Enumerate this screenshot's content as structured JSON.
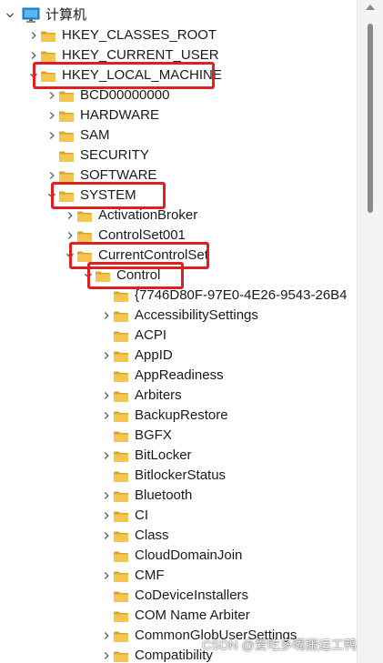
{
  "tree": {
    "root_label": "计算机",
    "items": [
      {
        "label": "HKEY_CLASSES_ROOT",
        "level": 1,
        "expander": "collapsed"
      },
      {
        "label": "HKEY_CURRENT_USER",
        "level": 1,
        "expander": "collapsed"
      },
      {
        "label": "HKEY_LOCAL_MACHINE",
        "level": 1,
        "expander": "expanded"
      },
      {
        "label": "BCD00000000",
        "level": 2,
        "expander": "collapsed"
      },
      {
        "label": "HARDWARE",
        "level": 2,
        "expander": "collapsed"
      },
      {
        "label": "SAM",
        "level": 2,
        "expander": "collapsed"
      },
      {
        "label": "SECURITY",
        "level": 2,
        "expander": "none"
      },
      {
        "label": "SOFTWARE",
        "level": 2,
        "expander": "collapsed"
      },
      {
        "label": "SYSTEM",
        "level": 2,
        "expander": "expanded"
      },
      {
        "label": "ActivationBroker",
        "level": 3,
        "expander": "collapsed"
      },
      {
        "label": "ControlSet001",
        "level": 3,
        "expander": "collapsed"
      },
      {
        "label": "CurrentControlSet",
        "level": 3,
        "expander": "expanded"
      },
      {
        "label": "Control",
        "level": 4,
        "expander": "expanded"
      },
      {
        "label": "{7746D80F-97E0-4E26-9543-26B4",
        "level": 5,
        "expander": "none"
      },
      {
        "label": "AccessibilitySettings",
        "level": 5,
        "expander": "collapsed"
      },
      {
        "label": "ACPI",
        "level": 5,
        "expander": "none"
      },
      {
        "label": "AppID",
        "level": 5,
        "expander": "collapsed"
      },
      {
        "label": "AppReadiness",
        "level": 5,
        "expander": "none"
      },
      {
        "label": "Arbiters",
        "level": 5,
        "expander": "collapsed"
      },
      {
        "label": "BackupRestore",
        "level": 5,
        "expander": "collapsed"
      },
      {
        "label": "BGFX",
        "level": 5,
        "expander": "none"
      },
      {
        "label": "BitLocker",
        "level": 5,
        "expander": "collapsed"
      },
      {
        "label": "BitlockerStatus",
        "level": 5,
        "expander": "none"
      },
      {
        "label": "Bluetooth",
        "level": 5,
        "expander": "collapsed"
      },
      {
        "label": "CI",
        "level": 5,
        "expander": "collapsed"
      },
      {
        "label": "Class",
        "level": 5,
        "expander": "collapsed"
      },
      {
        "label": "CloudDomainJoin",
        "level": 5,
        "expander": "none"
      },
      {
        "label": "CMF",
        "level": 5,
        "expander": "collapsed"
      },
      {
        "label": "CoDeviceInstallers",
        "level": 5,
        "expander": "none"
      },
      {
        "label": "COM Name Arbiter",
        "level": 5,
        "expander": "none"
      },
      {
        "label": "CommonGlobUserSettings",
        "level": 5,
        "expander": "collapsed"
      },
      {
        "label": "Compatibility",
        "level": 5,
        "expander": "collapsed"
      }
    ]
  },
  "highlighted": [
    "HKEY_LOCAL_MACHINE",
    "SYSTEM",
    "CurrentControlSet",
    "Control"
  ],
  "colors": {
    "folder": "#f3c64f",
    "folder_dark": "#dca42c",
    "highlight_box": "#e02020",
    "scroll_thumb": "#8a8a8a"
  },
  "watermark": "CSDN @爱吃多嘴搬运工鸭",
  "icons": {
    "root": "computer-icon",
    "folder": "folder-icon",
    "expanded": "chevron-down-icon",
    "collapsed": "chevron-right-icon"
  }
}
